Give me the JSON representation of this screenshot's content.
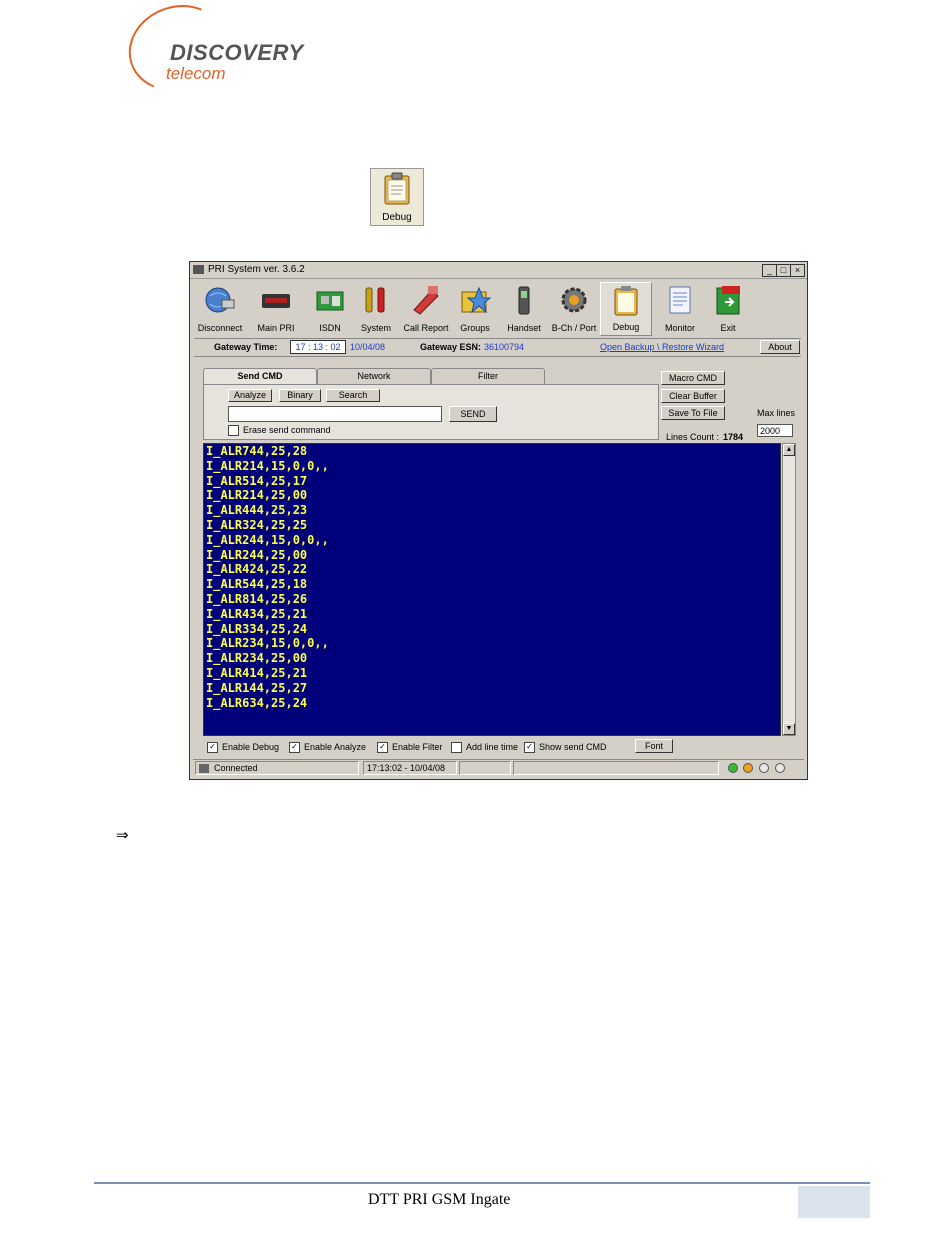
{
  "logo": {
    "main": "DISCOVERY",
    "sub": "telecom"
  },
  "debug_button_label": "Debug",
  "window": {
    "title": "PRI System ver. 3.6.2",
    "controls": [
      "_",
      "□",
      "×"
    ],
    "toolbar": [
      {
        "label": "Disconnect",
        "icon": "disconnect-icon"
      },
      {
        "label": "Main PRI",
        "icon": "main-pri-icon"
      },
      {
        "label": "ISDN",
        "icon": "isdn-card-icon"
      },
      {
        "label": "System",
        "icon": "system-tools-icon"
      },
      {
        "label": "Call Report",
        "icon": "call-report-icon"
      },
      {
        "label": "Groups",
        "icon": "groups-icon"
      },
      {
        "label": "Handset",
        "icon": "handset-icon"
      },
      {
        "label": "B-Ch / Port",
        "icon": "gear-icon"
      },
      {
        "label": "Debug",
        "icon": "clipboard-icon"
      },
      {
        "label": "Monitor",
        "icon": "monitor-icon"
      },
      {
        "label": "Exit",
        "icon": "exit-icon"
      }
    ],
    "gateway": {
      "time_label": "Gateway Time:",
      "time": "17 : 13 : 02",
      "date": "10/04/08",
      "esn_label": "Gateway ESN:",
      "esn": "36100794",
      "wizard_link": "Open Backup \\ Restore Wizard",
      "about": "About"
    },
    "tabs": [
      "Send CMD",
      "Network",
      "Filter"
    ],
    "panel": {
      "analyze": "Analyze",
      "binary": "Binary",
      "search": "Search",
      "command_value": "",
      "send": "SEND",
      "erase_label": "Erase send command"
    },
    "side": {
      "macro": "Macro CMD",
      "clear": "Clear Buffer",
      "save": "Save To File",
      "max_lines_label": "Max lines",
      "max_lines": "2000",
      "lines_count_label": "Lines Count :",
      "lines_count": "1784"
    },
    "console_lines": [
      "I_ALR744,25,28",
      "I_ALR214,15,0,0,,",
      "I_ALR514,25,17",
      "I_ALR214,25,00",
      "I_ALR444,25,23",
      "I_ALR324,25,25",
      "I_ALR244,15,0,0,,",
      "I_ALR244,25,00",
      "I_ALR424,25,22",
      "I_ALR544,25,18",
      "I_ALR814,25,26",
      "I_ALR434,25,21",
      "I_ALR334,25,24",
      "I_ALR234,15,0,0,,",
      "I_ALR234,25,00",
      "I_ALR414,25,21",
      "I_ALR144,25,27",
      "I_ALR634,25,24"
    ],
    "options": [
      {
        "label": "Enable Debug",
        "checked": true
      },
      {
        "label": "Enable Analyze",
        "checked": true
      },
      {
        "label": "Enable Filter",
        "checked": true
      },
      {
        "label": "Add line time",
        "checked": false
      },
      {
        "label": "Show send CMD",
        "checked": true
      }
    ],
    "font_btn": "Font",
    "status": {
      "connection": "Connected",
      "timestamp": "17:13:02 - 10/04/08"
    },
    "colors": {
      "console_bg": "#00007a",
      "console_text": "#ffff44",
      "accent": "#e0632a"
    }
  },
  "arrow_symbol": "⇒",
  "footer": {
    "title": "DTT PRI GSM Ingate"
  }
}
